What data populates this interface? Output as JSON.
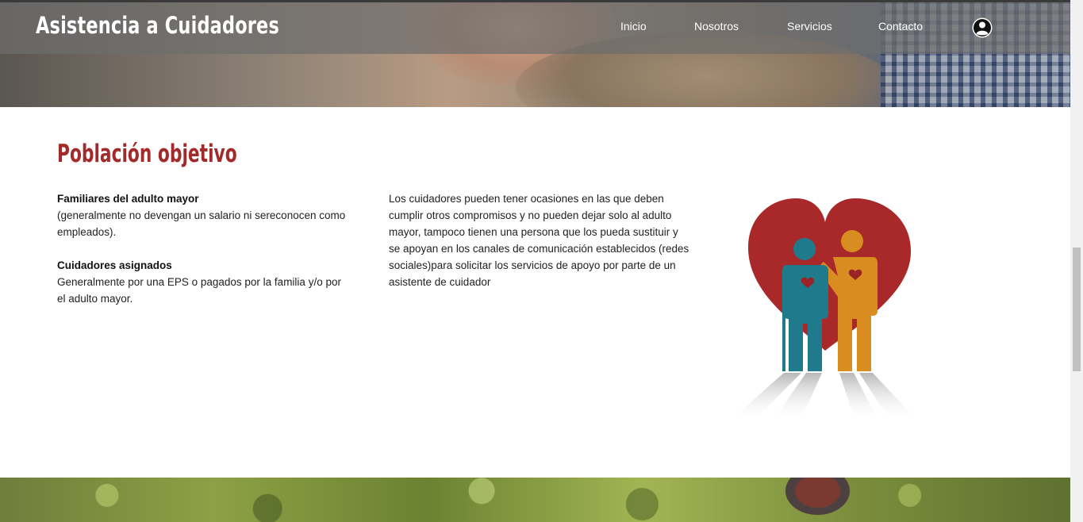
{
  "header": {
    "brand": "Asistencia a Cuidadores",
    "nav": [
      {
        "label": "Inicio"
      },
      {
        "label": "Nosotros"
      },
      {
        "label": "Servicios"
      },
      {
        "label": "Contacto"
      }
    ],
    "user_icon": "user-circle-icon"
  },
  "section": {
    "title": "Población objetivo",
    "group1_heading": "Familiares del adulto mayor",
    "group1_text": "(generalmente no devengan un salario ni sereconocen como empleados).",
    "group2_heading": "Cuidadores asignados",
    "group2_text": "Generalmente por una EPS o pagados por la familia y/o por el adulto mayor.",
    "description": "Los cuidadores pueden tener ocasiones en las que deben cumplir otros compromisos y no pueden dejar solo al adulto mayor, tampoco tienen una persona que los pueda sustituir y se apoyan en los canales de comunicación establecidos (redes sociales)para solicitar los servicios de apoyo por parte de un asistente de cuidador"
  },
  "colors": {
    "accent": "#a32a2a",
    "heart": "#b82c2f",
    "elder_figure": "#1f7a8c",
    "caregiver_figure": "#d98c1f"
  }
}
